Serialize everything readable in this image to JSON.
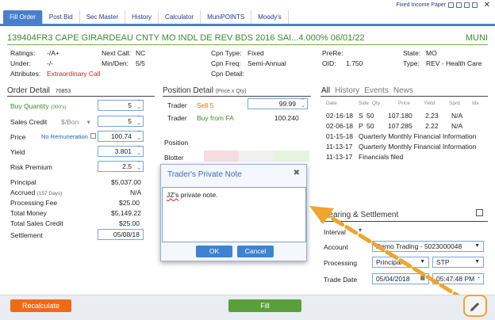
{
  "tabs": [
    "Fill Order",
    "Post Bid",
    "Sec Master",
    "History",
    "Calculator",
    "MuniPOINTS",
    "Moody's"
  ],
  "header_right": "Fixed Income Paper",
  "security": {
    "id": "139404FR3  CAPE GIRARDEAU CNTY MO INDL DE REV BDS 2016 SAI...4.000% 06/01/22",
    "type": "MUNI"
  },
  "info": {
    "ratings_label": "Ratings:",
    "ratings": "-/A+",
    "under_label": "Under:",
    "under": "-/-",
    "attributes_label": "Attributes:",
    "attributes": "Extraordinary Call",
    "next_call_label": "Next Call:",
    "next_call": "NC",
    "min_den_label": "Min/Den:",
    "min_den": "5/5",
    "cpn_type_label": "Cpn Type:",
    "cpn_type": "Fixed",
    "cpn_freq_label": "Cpn Freq:",
    "cpn_freq": "Semi-Annual",
    "cpn_detail_label": "Cpn Detail:",
    "prere_label": "PreRe:",
    "oid_label": "OID:",
    "oid": "1.750",
    "state_label": "State:",
    "state": "MO",
    "type_label": "Type:",
    "type": "REV - Health Care"
  },
  "order": {
    "title": "Order Detail",
    "acct": "70853",
    "buy_qty_label": "Buy Quantity",
    "buy_qty_unit": "(000's)",
    "buy_qty": "5",
    "sales_credit_label": "Sales Credit",
    "sales_credit_unit": "$/Bon",
    "sales_credit": "5",
    "price_label": "Price",
    "no_remuneration": "No Remuneration",
    "price": "100.74",
    "yield_label": "Yield",
    "yield": "3.801",
    "risk_label": "Risk Premium",
    "risk": "2.5",
    "principal_label": "Principal",
    "principal": "$5,037.00",
    "accrued_label": "Accrued",
    "accrued_days": "(157 Days)",
    "accrued": "N/A",
    "proc_fee_label": "Processing Fee",
    "proc_fee": "$25.00",
    "total_money_label": "Total Money",
    "total_money": "$5,149.22",
    "total_sc_label": "Total Sales Credit",
    "total_sc": "$25.00",
    "settlement_label": "Settlement",
    "settlement": "05/08/18"
  },
  "position": {
    "title": "Position Detail",
    "subtitle": "(Price x Qty)",
    "trader1": "Trader",
    "trader1_action": "Sell 5",
    "trader1_val": "99.99",
    "trader2": "Trader",
    "trader2_action": "Buy from FA",
    "trader2_val": "100.240",
    "position_label": "Position",
    "blotter_label": "Blotter"
  },
  "history": {
    "tabs": [
      "All",
      "History",
      "Events",
      "News"
    ],
    "cols": [
      "Date",
      "Side",
      "Qty",
      "Price",
      "Yield",
      "Sprd",
      "Idx"
    ],
    "rows": [
      {
        "date": "02-16-18",
        "side": "S",
        "qty": "50",
        "price": "107.180",
        "yield": "2.23",
        "sprd": "N/A"
      },
      {
        "date": "02-06-18",
        "side": "P",
        "qty": "50",
        "price": "107.285",
        "yield": "2.22",
        "sprd": "N/A"
      }
    ],
    "events": [
      {
        "date": "01-15-18",
        "text": "Quarterly Monthly Financial Information"
      },
      {
        "date": "11-13-17",
        "text": "Quarterly Monthly Financial Information"
      },
      {
        "date": "11-13-17",
        "text": "Financials filed"
      }
    ]
  },
  "clearing": {
    "title": "Clearing & Settlement",
    "interval_label": "Interval",
    "account_label": "Account",
    "account": "Demo Trading - 5023000048",
    "processing_label": "Processing",
    "processing": "Principal",
    "stp": "STP",
    "trade_date_label": "Trade Date",
    "trade_date": "05/04/2018",
    "trade_time": "05:47:48 PM"
  },
  "modal": {
    "title": "Trader's Private Note",
    "text_initials": "JZ's",
    "text_rest": " private note.",
    "ok": "OK",
    "cancel": "Cancel"
  },
  "footer": {
    "recalculate": "Recalculate",
    "fill": "Fill"
  },
  "colors": {
    "accent": "#4a7fcc",
    "green": "#3a8b2a",
    "orange": "#ef6a17",
    "highlight": "#f0a52c"
  }
}
